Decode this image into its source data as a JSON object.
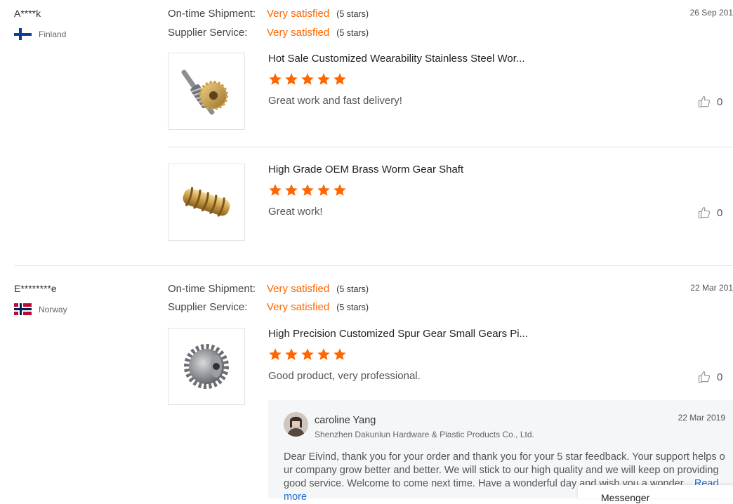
{
  "reviews": [
    {
      "buyer": "A****k",
      "country": "Finland",
      "date": "26 Sep 201",
      "ratings": [
        {
          "label": "On-time Shipment:",
          "value": "Very satisfied",
          "stars": "(5 stars)"
        },
        {
          "label": "Supplier Service:",
          "value": "Very satisfied",
          "stars": "(5 stars)"
        }
      ],
      "products": [
        {
          "title": "Hot Sale Customized Wearability Stainless Steel Wor...",
          "stars": 5,
          "comment": "Great work and fast delivery!",
          "likes": "0",
          "image_icon": "worm-gear-set-icon"
        },
        {
          "title": "High Grade OEM Brass Worm Gear Shaft",
          "stars": 5,
          "comment": "Great work!",
          "likes": "0",
          "image_icon": "brass-worm-shaft-icon"
        }
      ]
    },
    {
      "buyer": "E********e",
      "country": "Norway",
      "date": "22 Mar 201",
      "ratings": [
        {
          "label": "On-time Shipment:",
          "value": "Very satisfied",
          "stars": "(5 stars)"
        },
        {
          "label": "Supplier Service:",
          "value": "Very satisfied",
          "stars": "(5 stars)"
        }
      ],
      "products": [
        {
          "title": "High Precision Customized Spur Gear Small Gears Pi...",
          "stars": 5,
          "comment": "Good product, very professional.",
          "likes": "0",
          "image_icon": "spur-gear-icon"
        }
      ],
      "reply": {
        "name": "caroline Yang",
        "company": "Shenzhen Dakunlun Hardware & Plastic Products Co., Ltd.",
        "date": "22 Mar 2019",
        "text": "Dear Eivind, thank you for your order and thank you for your 5 star feedback. Your support helps our company grow better and better. We will stick to our high quality and we will keep on providing good service. Welcome to come next time. Have a wonderful day and wish you a wonder...",
        "read_more": "Read more"
      }
    }
  ],
  "messenger": {
    "label": "Messenger"
  },
  "colors": {
    "accent": "#ff6600",
    "link": "#1f6cd0",
    "reply_bg": "#f5f6f8"
  }
}
